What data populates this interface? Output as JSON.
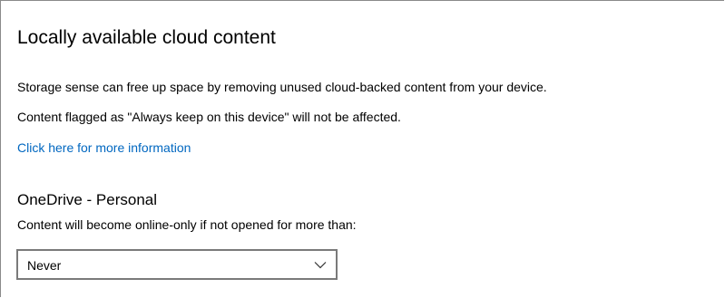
{
  "section": {
    "title": "Locally available cloud content",
    "description_line1": "Storage sense can free up space by removing unused cloud-backed content from your device.",
    "description_line2": "Content flagged as \"Always keep on this device\" will not be affected.",
    "link_text": "Click here for more information"
  },
  "onedrive": {
    "title": "OneDrive - Personal",
    "description": "Content will become online-only if not opened for more than:",
    "dropdown": {
      "selected": "Never",
      "icon": "chevron-down-icon"
    }
  },
  "colors": {
    "link": "#0067c0",
    "text": "#000000",
    "border": "#7a7a7a"
  }
}
